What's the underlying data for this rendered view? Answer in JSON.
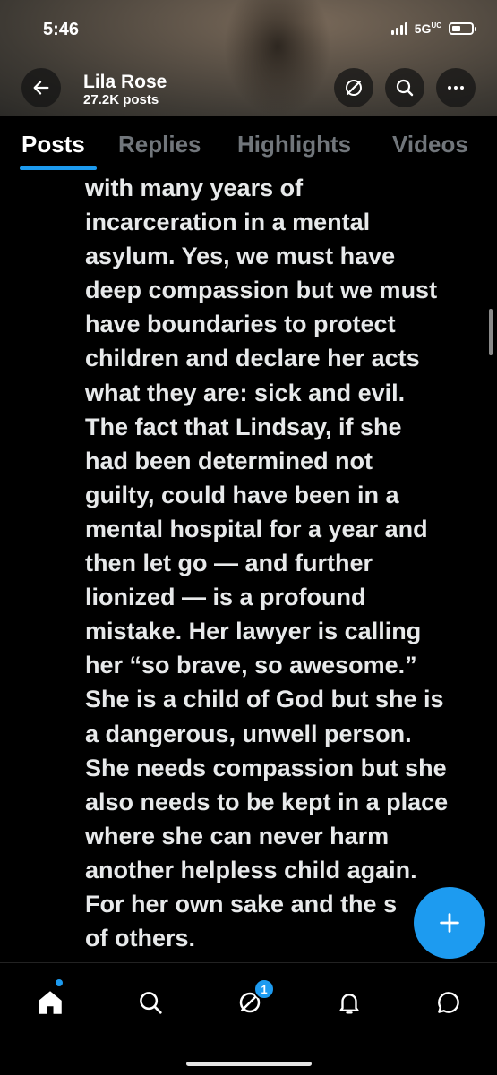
{
  "status_bar": {
    "time": "5:46",
    "network": "5G",
    "network_suffix": "UC"
  },
  "header": {
    "profile_name": "Lila Rose",
    "posts_count": "27.2K posts",
    "icons": [
      "back-arrow-icon",
      "grok-icon",
      "search-icon",
      "more-icon"
    ]
  },
  "tabs": [
    {
      "label": "Posts",
      "active": true
    },
    {
      "label": "Replies",
      "active": false
    },
    {
      "label": "Highlights",
      "active": false
    },
    {
      "label": "Videos",
      "active": false
    }
  ],
  "post": {
    "text": "with many years of\nincarceration in a mental\nasylum. Yes, we must have\ndeep compassion but we must\nhave boundaries to protect\nchildren and declare her acts\nwhat they are: sick and evil.\nThe fact that Lindsay, if she\nhad been determined not\nguilty, could have been in a\nmental hospital for a year and\nthen let go — and further\nlionized — is a profound\nmistake. Her lawyer is calling\nher “so brave, so awesome.”\nShe is a child of God but she is\na dangerous, unwell person.\nShe needs compassion but she\nalso needs to be kept in a place\nwhere she can never harm\nanother helpless child again.\nFor her own sake and the s\nof others."
  },
  "fab": {
    "icon": "plus-icon"
  },
  "bottom_nav": {
    "items": [
      "home-icon",
      "search-icon",
      "grok-icon",
      "notifications-icon",
      "messages-icon"
    ],
    "grok_badge": "1"
  },
  "colors": {
    "accent": "#1d9bf0",
    "background": "#000000",
    "text": "#e7e9ea",
    "muted": "#71767b"
  }
}
